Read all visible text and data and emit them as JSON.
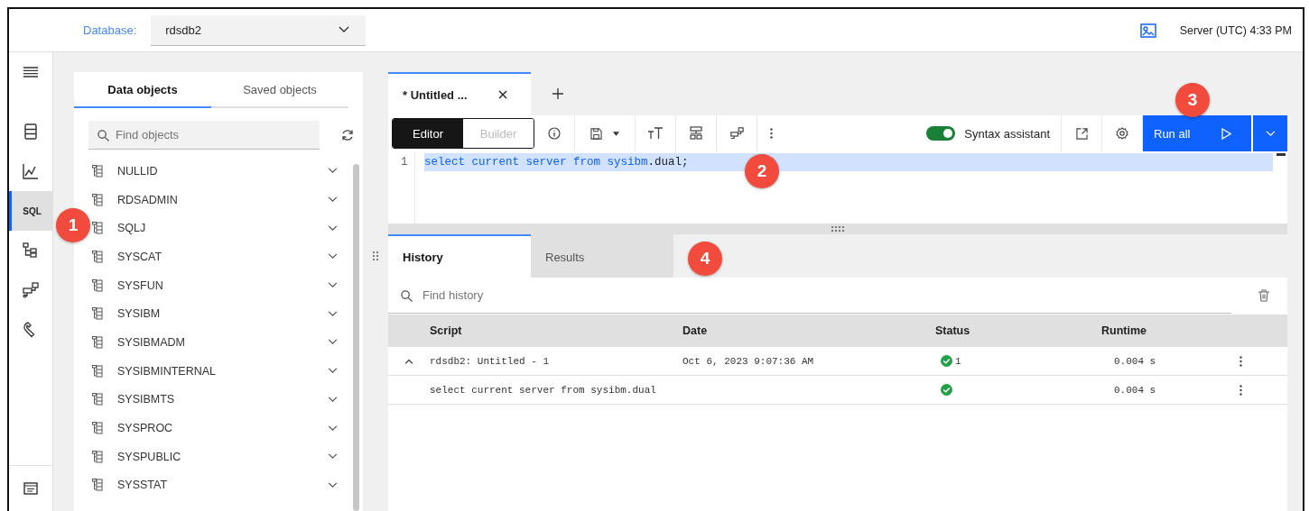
{
  "topbar": {
    "database_label": "Database:",
    "database": "rdsdb2",
    "server_time": "Server (UTC) 4:33 PM"
  },
  "rail": [
    {
      "kind": "menu",
      "selected": false
    },
    {
      "kind": "database",
      "selected": false
    },
    {
      "kind": "chart",
      "selected": false
    },
    {
      "kind": "sql",
      "label": "SQL",
      "selected": true
    },
    {
      "kind": "tree",
      "selected": false
    },
    {
      "kind": "flow",
      "selected": false
    },
    {
      "kind": "wrench",
      "selected": false
    }
  ],
  "objects_panel": {
    "tabs": [
      {
        "label": "Data objects",
        "selected": true
      },
      {
        "label": "Saved objects",
        "selected": false
      }
    ],
    "search": {
      "placeholder": "Find objects"
    },
    "schemas": [
      {
        "name": "NULLID"
      },
      {
        "name": "RDSADMIN"
      },
      {
        "name": "SQLJ"
      },
      {
        "name": "SYSCAT"
      },
      {
        "name": "SYSFUN"
      },
      {
        "name": "SYSIBM"
      },
      {
        "name": "SYSIBMADM"
      },
      {
        "name": "SYSIBMINTERNAL"
      },
      {
        "name": "SYSIBMTS"
      },
      {
        "name": "SYSPROC"
      },
      {
        "name": "SYSPUBLIC"
      },
      {
        "name": "SYSSTAT"
      }
    ]
  },
  "editor": {
    "tabs": [
      {
        "label": "* Untitled ...",
        "selected": true
      }
    ],
    "modes": [
      {
        "label": "Editor",
        "selected": true
      },
      {
        "label": "Builder",
        "selected": false
      }
    ],
    "syntax_assistant": {
      "label": "Syntax assistant",
      "on": true
    },
    "run_button": "Run all",
    "lines": [
      {
        "number": "1",
        "tokens": [
          {
            "text": "select current server from sysibm",
            "kind": "keyword"
          },
          {
            "text": ".dual;",
            "kind": "plain"
          }
        ]
      }
    ]
  },
  "results": {
    "tabs": [
      {
        "label": "History",
        "selected": true
      },
      {
        "label": "Results",
        "selected": false
      }
    ],
    "search": {
      "placeholder": "Find history"
    },
    "columns": [
      "Script",
      "Date",
      "Status",
      "Runtime"
    ],
    "rows": [
      {
        "script": "rdsdb2: Untitled - 1",
        "date": "Oct 6, 2023 9:07:36 AM",
        "status_count": "1",
        "runtime": "0.004 s",
        "expanded": true,
        "children": [
          {
            "script": "select current server from sysibm.dual",
            "runtime": "0.004 s"
          }
        ]
      }
    ]
  },
  "callouts": [
    {
      "label": "1"
    },
    {
      "label": "2"
    },
    {
      "label": "3"
    },
    {
      "label": "4"
    }
  ]
}
